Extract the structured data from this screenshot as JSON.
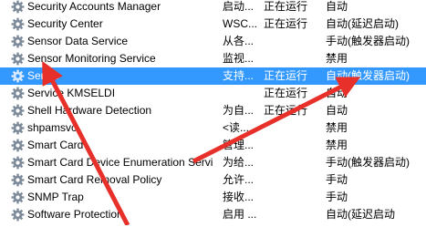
{
  "services": [
    {
      "name": "Security Accounts Manager",
      "desc": "启动...",
      "status": "正在运行",
      "startup": "自动",
      "selected": false
    },
    {
      "name": "Security Center",
      "desc": "WSC...",
      "status": "正在运行",
      "startup": "自动(延迟启动)",
      "selected": false
    },
    {
      "name": "Sensor Data Service",
      "desc": "从各...",
      "status": "",
      "startup": "手动(触发器启动)",
      "selected": false
    },
    {
      "name": "Sensor Monitoring Service",
      "desc": "监视...",
      "status": "",
      "startup": "禁用",
      "selected": false
    },
    {
      "name": "Server",
      "desc": "支持...",
      "status": "正在运行",
      "startup": "自动(触发器启动)",
      "selected": true
    },
    {
      "name": "Service KMSELDI",
      "desc": "",
      "status": "正在运行",
      "startup": "自动",
      "selected": false
    },
    {
      "name": "Shell Hardware Detection",
      "desc": "为自...",
      "status": "正在运行",
      "startup": "自动",
      "selected": false
    },
    {
      "name": "shpamsvc",
      "desc": "<读...",
      "status": "",
      "startup": "禁用",
      "selected": false
    },
    {
      "name": "Smart Card",
      "desc": "管理...",
      "status": "",
      "startup": "禁用",
      "selected": false
    },
    {
      "name": "Smart Card Device Enumeration Servi",
      "desc": "为给...",
      "status": "",
      "startup": "手动(触发器启动)",
      "selected": false
    },
    {
      "name": "Smart Card Removal Policy",
      "desc": "允许...",
      "status": "",
      "startup": "手动",
      "selected": false
    },
    {
      "name": "SNMP Trap",
      "desc": "接收...",
      "status": "",
      "startup": "手动",
      "selected": false
    },
    {
      "name": "Software Protection",
      "desc": "启用 ...",
      "status": "",
      "startup": "自动(延迟启动",
      "selected": false
    }
  ],
  "icon": "gear-service-icon",
  "colors": {
    "selection": "#3399ff",
    "arrow": "#e8302a"
  }
}
